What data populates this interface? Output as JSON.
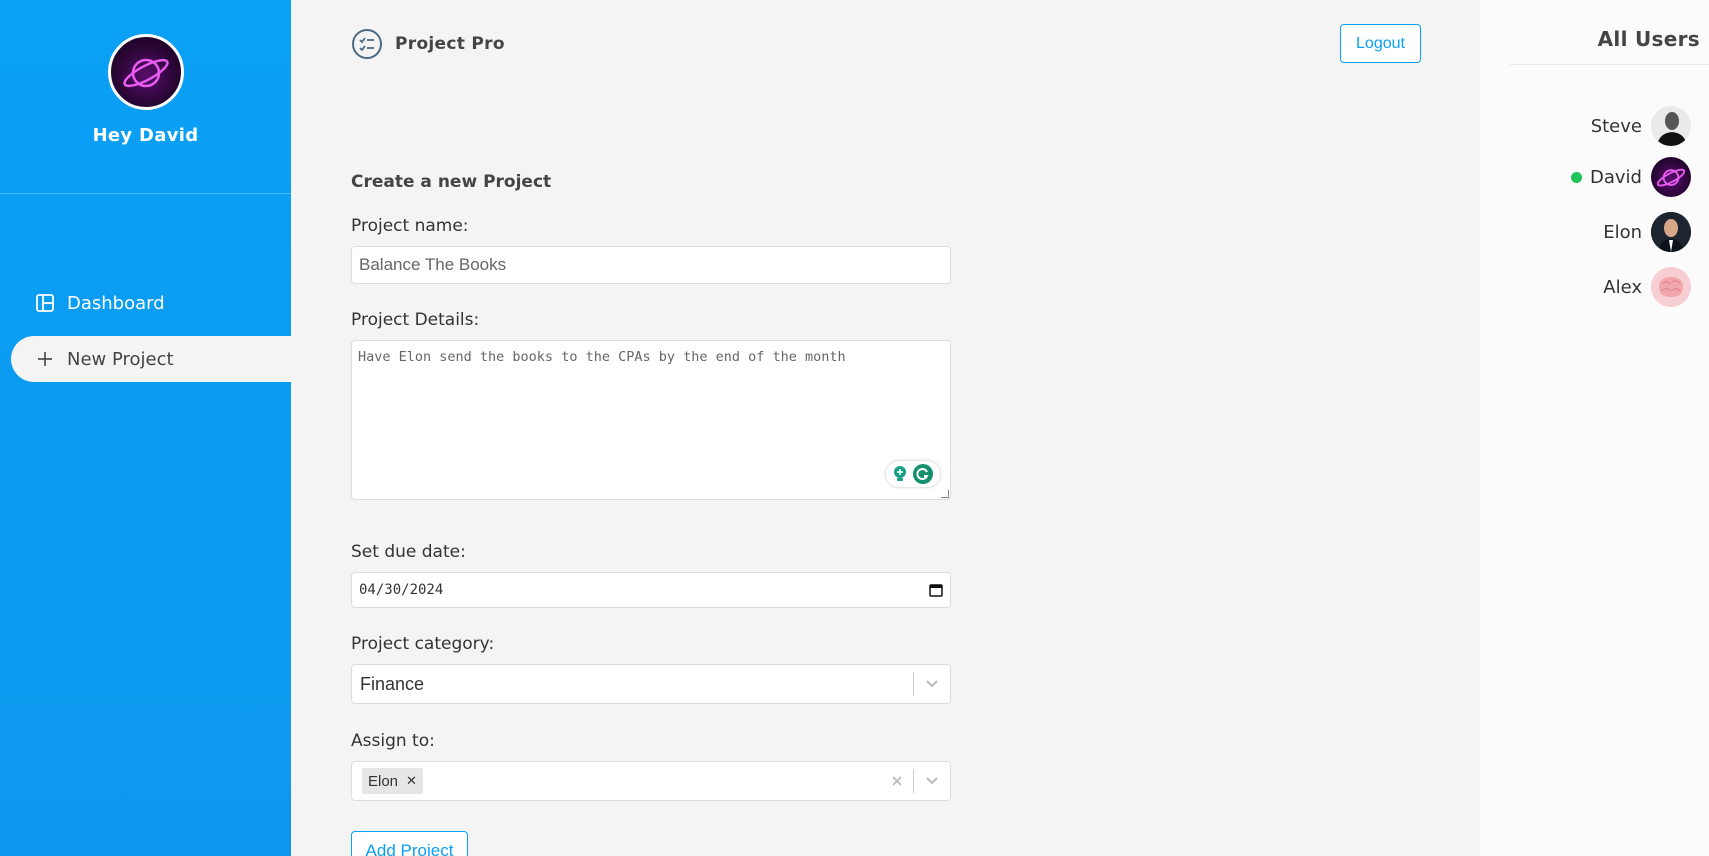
{
  "sidebar": {
    "greeting": "Hey David",
    "nav": [
      {
        "label": "Dashboard",
        "icon": "dashboard-icon",
        "active": false
      },
      {
        "label": "New Project",
        "icon": "plus-icon",
        "active": true
      }
    ]
  },
  "header": {
    "brand": "Project Pro",
    "logout_label": "Logout"
  },
  "form": {
    "title": "Create a new Project",
    "name_label": "Project name:",
    "name_value": "Balance The Books",
    "details_label": "Project Details:",
    "details_value": "Have Elon send the books to the CPAs by the end of the month",
    "due_label": "Set due date:",
    "due_value": "04/30/2024",
    "category_label": "Project category:",
    "category_value": "Finance",
    "assign_label": "Assign to:",
    "assigned": [
      "Elon"
    ],
    "submit_label": "Add Project"
  },
  "users": {
    "title": "All Users",
    "list": [
      {
        "name": "Steve",
        "online": false
      },
      {
        "name": "David",
        "online": true
      },
      {
        "name": "Elon",
        "online": false
      },
      {
        "name": "Alex",
        "online": false
      }
    ]
  },
  "colors": {
    "sidebar": "#0aa0f5",
    "accent": "#0aa0f5",
    "online": "#1ec25a"
  }
}
